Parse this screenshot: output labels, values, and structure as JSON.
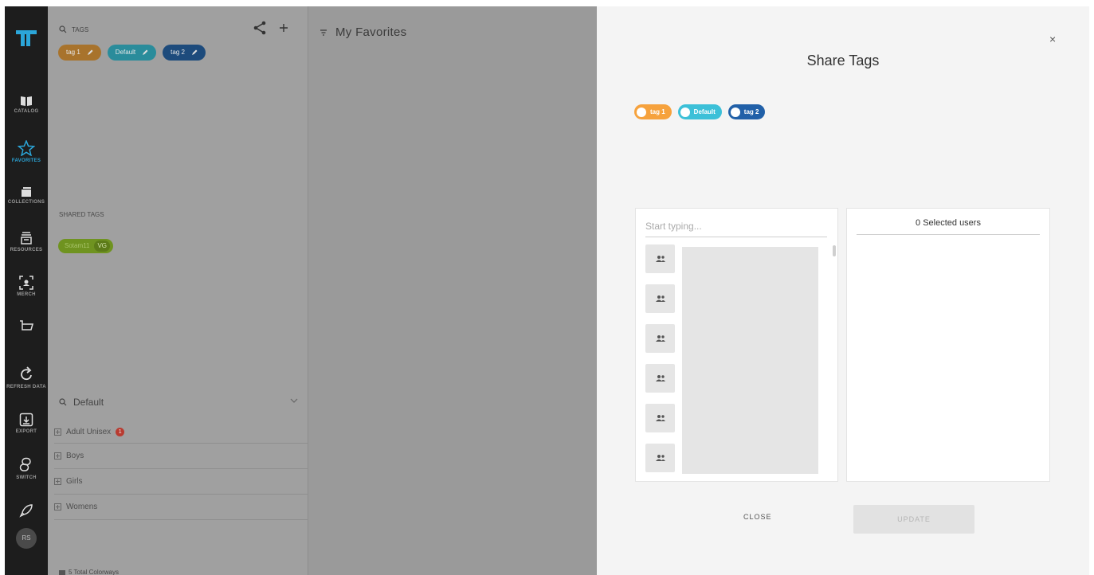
{
  "nav": {
    "items": [
      {
        "label": "CATALOG",
        "icon": "book-icon"
      },
      {
        "label": "FAVORITES",
        "icon": "star-icon"
      },
      {
        "label": "COLLECTIONS",
        "icon": "collections-icon"
      },
      {
        "label": "RESOURCES",
        "icon": "resources-icon"
      },
      {
        "label": "MERCH",
        "icon": "merch-icon"
      },
      {
        "label": "",
        "icon": "cart-icon"
      },
      {
        "label": "REFRESH DATA",
        "icon": "refresh-icon"
      },
      {
        "label": "EXPORT",
        "icon": "export-icon"
      },
      {
        "label": "SWITCH",
        "icon": "switch-icon"
      },
      {
        "label": "",
        "icon": "rocket-icon"
      }
    ],
    "avatar": "RS",
    "accent": "#2ba6d9"
  },
  "tags_panel": {
    "search_label": "TAGS",
    "tags": [
      {
        "label": "tag 1",
        "color": "#a8732c"
      },
      {
        "label": "Default",
        "color": "#2a8c9b"
      },
      {
        "label": "tag 2",
        "color": "#1d4b7c"
      }
    ],
    "shared_label": "SHARED TAGS",
    "shared_tag": {
      "label": "Sotam11",
      "badge": "VG"
    },
    "default_search": "Default",
    "categories": [
      {
        "label": "Adult Unisex",
        "badge": "1"
      },
      {
        "label": "Boys"
      },
      {
        "label": "Girls"
      },
      {
        "label": "Womens"
      }
    ],
    "footer": "5 Total Colorways"
  },
  "main": {
    "title": "My Favorites"
  },
  "modal": {
    "title": "Share Tags",
    "close_symbol": "×",
    "tags": [
      {
        "label": "tag 1",
        "color": "#f6a23d"
      },
      {
        "label": "Default",
        "color": "#3cc0d8"
      },
      {
        "label": "tag 2",
        "color": "#2160a8"
      }
    ],
    "search_placeholder": "Start typing...",
    "selected_users": "0 Selected users",
    "close_button": "CLOSE",
    "update_button": "UPDATE"
  }
}
